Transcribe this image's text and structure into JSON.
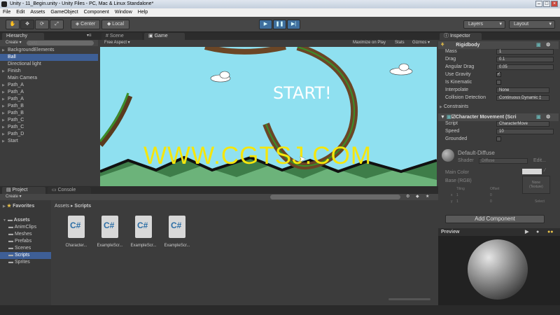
{
  "window": {
    "title": "Unity - 11_Begin.unity - Unity Files - PC, Mac & Linux Standalone*"
  },
  "menu": [
    "File",
    "Edit",
    "Assets",
    "GameObject",
    "Component",
    "Window",
    "Help"
  ],
  "toolbar": {
    "center_label": "Center",
    "local_label": "Local",
    "layers_label": "Layers",
    "layout_label": "Layout"
  },
  "hierarchy": {
    "tab": "Hierarchy",
    "create": "Create",
    "search_placeholder": "Q▾All",
    "items": [
      {
        "label": "BackgroundElements",
        "expandable": true,
        "selected": false
      },
      {
        "label": "Ball",
        "expandable": false,
        "selected": true
      },
      {
        "label": "Directional light",
        "expandable": false,
        "selected": false
      },
      {
        "label": "Finish",
        "expandable": true,
        "selected": false
      },
      {
        "label": "Main Camera",
        "expandable": false,
        "selected": false
      },
      {
        "label": "Path_A",
        "expandable": true,
        "selected": false
      },
      {
        "label": "Path_A",
        "expandable": true,
        "selected": false
      },
      {
        "label": "Path_A",
        "expandable": true,
        "selected": false
      },
      {
        "label": "Path_B",
        "expandable": true,
        "selected": false
      },
      {
        "label": "Path_B",
        "expandable": true,
        "selected": false
      },
      {
        "label": "Path_C",
        "expandable": true,
        "selected": false
      },
      {
        "label": "Path_C",
        "expandable": true,
        "selected": false
      },
      {
        "label": "Path_D",
        "expandable": true,
        "selected": false
      },
      {
        "label": "Start",
        "expandable": true,
        "selected": false
      }
    ]
  },
  "center": {
    "tabs": [
      "Scene",
      "Game"
    ],
    "aspect": "Free Aspect",
    "options": [
      "Maximize on Play",
      "Stats",
      "Gizmos"
    ],
    "game_text": "START!",
    "watermark": "WWW.CGTSJ.COM"
  },
  "project": {
    "tabs": [
      "Project",
      "Console"
    ],
    "create": "Create",
    "favorites": "Favorites",
    "assets_root": "Assets",
    "folders": [
      "AnimClips",
      "Meshes",
      "Prefabs",
      "Scenes",
      "Scripts",
      "Sprites"
    ],
    "selected_folder": "Scripts",
    "breadcrumb": [
      "Assets",
      "Scripts"
    ],
    "files": [
      "Character...",
      "ExampleScr...",
      "ExampleScr...",
      "ExampleScr..."
    ]
  },
  "inspector": {
    "tab": "Inspector",
    "rigidbody": {
      "title": "Rigidbody",
      "fields": [
        {
          "label": "Mass",
          "value": "1",
          "type": "text"
        },
        {
          "label": "Drag",
          "value": "0.1",
          "type": "text"
        },
        {
          "label": "Angular Drag",
          "value": "0.05",
          "type": "text"
        },
        {
          "label": "Use Gravity",
          "value": "✓",
          "type": "check"
        },
        {
          "label": "Is Kinematic",
          "value": "",
          "type": "check"
        },
        {
          "label": "Interpolate",
          "value": "None",
          "type": "select"
        },
        {
          "label": "Collision Detection",
          "value": "Continuous Dynamic ‡",
          "type": "select"
        }
      ],
      "constraints": "Constraints"
    },
    "character": {
      "title": "Character Movement (Scri",
      "fields": [
        {
          "label": "Script",
          "value": "CharacterMove",
          "type": "obj"
        },
        {
          "label": "Speed",
          "value": "10",
          "type": "text"
        },
        {
          "label": "Grounded",
          "value": "",
          "type": "check"
        }
      ]
    },
    "material": {
      "name": "Default-Diffuse",
      "shader_label": "Shader",
      "shader_value": "Diffuse",
      "edit": "Edit...",
      "main_color": "Main Color",
      "base": "Base (RGB)",
      "tiling": "Tiling",
      "offset": "Offset",
      "x_label": "x",
      "y_label": "y",
      "tiling_x": "1",
      "tiling_y": "1",
      "offset_x": "0",
      "offset_y": "0",
      "none_texture": "None\n(Texture)",
      "select": "Select"
    },
    "add_component": "Add Component",
    "preview": "Preview"
  },
  "colors": {
    "sky": "#8fe0f0",
    "selection": "#3e5f96",
    "grass": "#4f9a56",
    "watermark": "#f5e60c"
  }
}
